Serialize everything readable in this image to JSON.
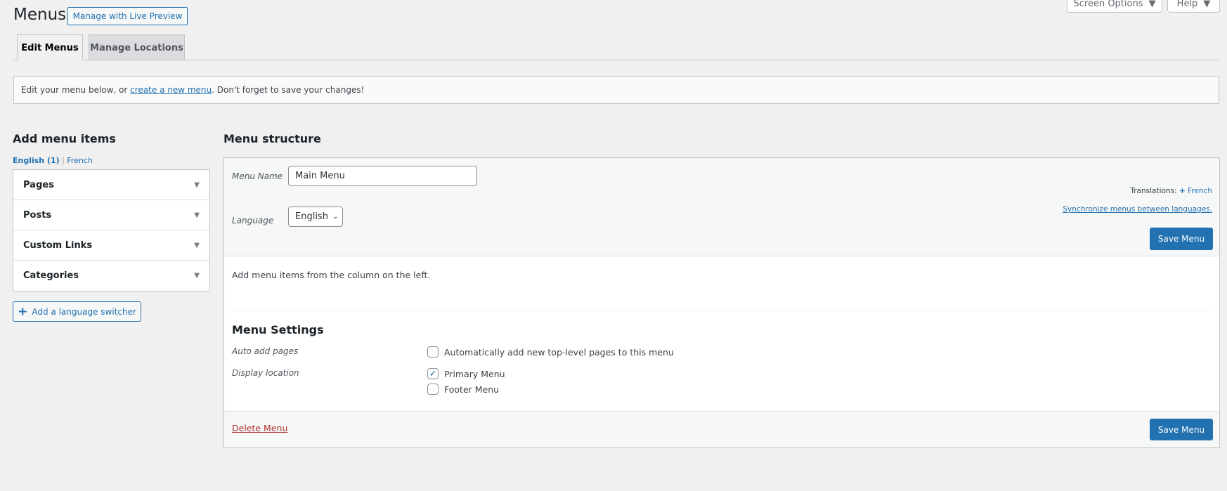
{
  "header": {
    "title": "Menus",
    "live_preview": "Manage with Live Preview",
    "screen_options": "Screen Options",
    "help": "Help"
  },
  "tabs": [
    {
      "label": "Edit Menus",
      "active": true
    },
    {
      "label": "Manage Locations",
      "active": false
    }
  ],
  "notice": {
    "before": "Edit your menu below, or ",
    "link": "create a new menu",
    "after": ". Don't forget to save your changes!"
  },
  "left": {
    "heading": "Add menu items",
    "lang_active": "English (1)",
    "lang_sep": "|",
    "lang_other": "French",
    "sections": [
      "Pages",
      "Posts",
      "Custom Links",
      "Categories"
    ],
    "switcher": "Add a language switcher"
  },
  "structure": {
    "heading": "Menu structure",
    "menu_name_label": "Menu Name",
    "menu_name_value": "Main Menu",
    "language_label": "Language",
    "language_value": "English",
    "translations_label": "Translations:",
    "translations_link": "French",
    "sync_link": "Synchronize menus between languages.",
    "save": "Save Menu",
    "empty_text": "Add menu items from the column on the left.",
    "settings_heading": "Menu Settings",
    "auto_add_label": "Auto add pages",
    "auto_add_option": {
      "label": "Automatically add new top-level pages to this menu",
      "checked": false
    },
    "display_label": "Display location",
    "locations": [
      {
        "label": "Primary Menu",
        "checked": true
      },
      {
        "label": "Footer Menu",
        "checked": false
      }
    ],
    "delete": "Delete Menu"
  },
  "colors": {
    "accent": "#2271b1",
    "danger": "#b32d2e",
    "background": "#f0f0f1"
  }
}
